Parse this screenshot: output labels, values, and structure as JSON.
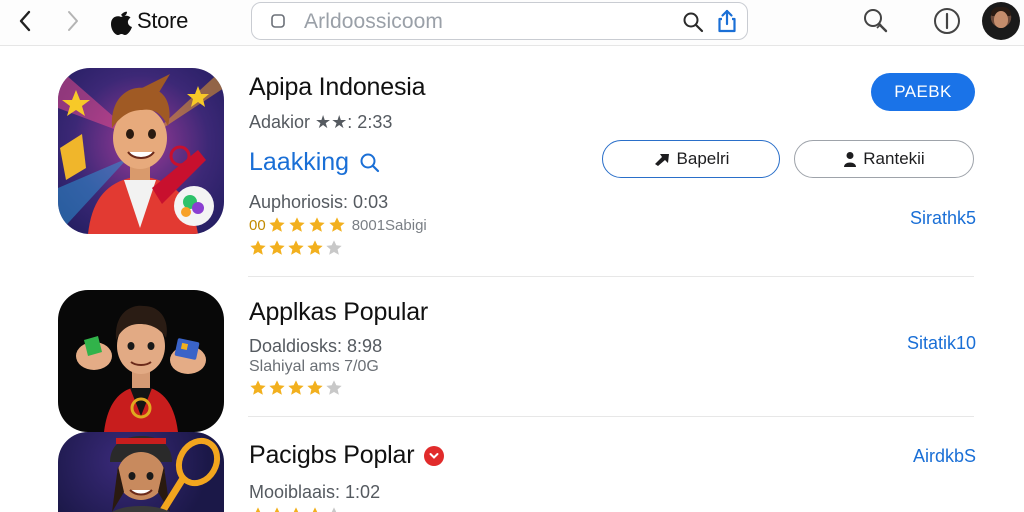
{
  "topbar": {
    "brand_label": "Store",
    "search_text": "Arldoossicoom"
  },
  "apps": [
    {
      "title": "Apipa Indonesia",
      "meta": "Adakior ★★: 2:33",
      "link": "Laakking",
      "sub_meta": "Auphoriosis: 0:03",
      "rating_prefix": "00",
      "rating_text": "8001Sabigi",
      "stars_filled": 4,
      "stars_total": 5,
      "side_link": "Sirathk5",
      "primary_button": "PAEBK",
      "button_a": "Bapelri",
      "button_b": "Rantekii"
    },
    {
      "title": "Applkas Popular",
      "meta": "Doaldiosks: 8:98",
      "sub_meta": "Slahiyal ams 7/0G",
      "stars_filled": 4,
      "stars_total": 5,
      "side_link": "Sitatik10"
    },
    {
      "title": "Pacigbs Poplar",
      "meta": "Mooiblaais: 1:02",
      "side_link": "AirdkbS",
      "stars_filled": 4,
      "stars_total": 5
    }
  ],
  "colors": {
    "accent": "#1a73e8",
    "link": "#1a6fd6",
    "star": "#f2b01e",
    "star_empty": "#c8c8c8",
    "badge": "#e12b2b"
  }
}
